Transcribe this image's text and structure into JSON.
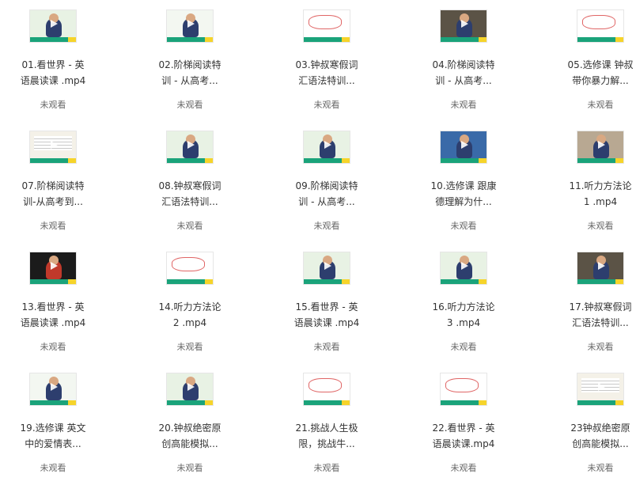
{
  "items": [
    {
      "line1": "01.看世界 - 英",
      "line2": "语晨读课 .mp4",
      "status": "未观看",
      "thumb": "person-green"
    },
    {
      "line1": "02.阶梯阅读特",
      "line2": "训 - 从高考...",
      "status": "未观看",
      "thumb": "person-slide"
    },
    {
      "line1": "03.钟叔寒假词",
      "line2": "汇语法特训...",
      "status": "未观看",
      "thumb": "sketch"
    },
    {
      "line1": "04.阶梯阅读特",
      "line2": "训 - 从高考...",
      "status": "未观看",
      "thumb": "person-dark"
    },
    {
      "line1": "05.选修课 钟叔",
      "line2": "带你暴力解...",
      "status": "未观看",
      "thumb": "sketch"
    },
    {
      "line1": "07.阶梯阅读特",
      "line2": "训-从高考到...",
      "status": "未观看",
      "thumb": "text"
    },
    {
      "line1": "08.钟叔寒假词",
      "line2": "汇语法特训...",
      "status": "未观看",
      "thumb": "person-green"
    },
    {
      "line1": "09.阶梯阅读特",
      "line2": "训 - 从高考...",
      "status": "未观看",
      "thumb": "person-green"
    },
    {
      "line1": "10.选修课 跟康",
      "line2": "德理解为什...",
      "status": "未观看",
      "thumb": "person-blue"
    },
    {
      "line1": "11.听力方法论",
      "line2": "1 .mp4",
      "status": "未观看",
      "thumb": "person-old"
    },
    {
      "line1": "13.看世界 - 英",
      "line2": "语晨读课 .mp4",
      "status": "未观看",
      "thumb": "person-black"
    },
    {
      "line1": "14.听力方法论",
      "line2": "2 .mp4",
      "status": "未观看",
      "thumb": "sketch"
    },
    {
      "line1": "15.看世界 - 英",
      "line2": "语晨读课 .mp4",
      "status": "未观看",
      "thumb": "person-green"
    },
    {
      "line1": "16.听力方法论",
      "line2": "3 .mp4",
      "status": "未观看",
      "thumb": "person-green"
    },
    {
      "line1": "17.钟叔寒假词",
      "line2": "汇语法特训...",
      "status": "未观看",
      "thumb": "person-dark"
    },
    {
      "line1": "19.选修课 英文",
      "line2": "中的爱情表...",
      "status": "未观看",
      "thumb": "person-slide"
    },
    {
      "line1": "20.钟叔绝密原",
      "line2": "创高能模拟...",
      "status": "未观看",
      "thumb": "person-green"
    },
    {
      "line1": "21.挑战人生极",
      "line2": "限，挑战牛...",
      "status": "未观看",
      "thumb": "sketch"
    },
    {
      "line1": "22.看世界 - 英",
      "line2": "语晨读课.mp4",
      "status": "未观看",
      "thumb": "sketch"
    },
    {
      "line1": "23钟叔绝密原",
      "line2": "创高能模拟...",
      "status": "未观看",
      "thumb": "text"
    }
  ]
}
